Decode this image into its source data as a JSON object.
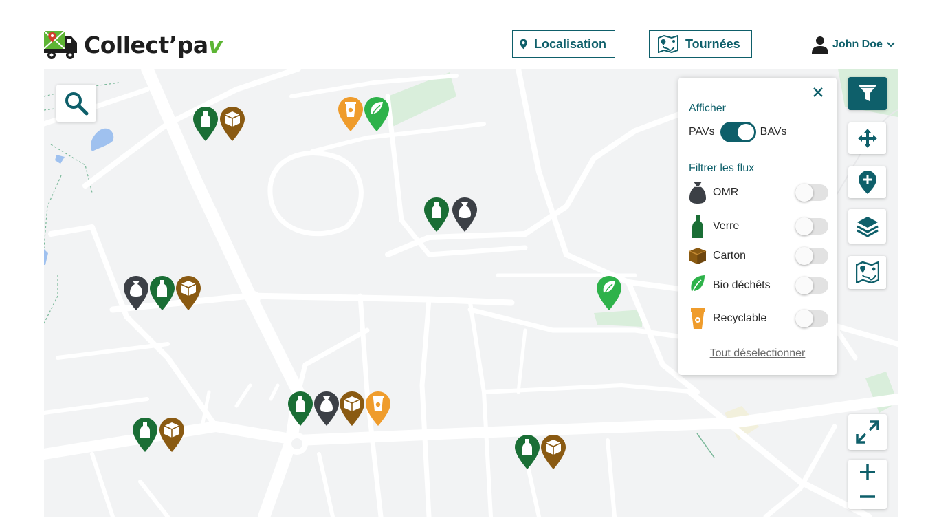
{
  "header": {
    "logo_text": "Collect’pa",
    "logo_accent": "v",
    "nav": {
      "localisation": "Localisation",
      "tournees": "Tournées"
    },
    "user_name": "John Doe"
  },
  "filter_panel": {
    "display_label": "Afficher",
    "toggle_left": "PAVs",
    "toggle_right": "BAVs",
    "filter_title": "Filtrer les flux",
    "flux": [
      {
        "label": "OMR",
        "icon": "trash-bag-icon",
        "enabled": false
      },
      {
        "label": "Verre",
        "icon": "bottle-icon",
        "enabled": false
      },
      {
        "label": "Carton",
        "icon": "box-icon",
        "enabled": false
      },
      {
        "label": "Bio déchêts",
        "icon": "leaf-icon",
        "enabled": false
      },
      {
        "label": "Recyclable",
        "icon": "cup-icon",
        "enabled": false
      }
    ],
    "deselect_label": "Tout déselectionner"
  },
  "colors": {
    "primary": "#0e5f6a",
    "verre": "#1a6e35",
    "omr": "#3c4046",
    "carton": "#8a5a12",
    "bio": "#2eb24a",
    "recyclable": "#ef9c2c"
  }
}
